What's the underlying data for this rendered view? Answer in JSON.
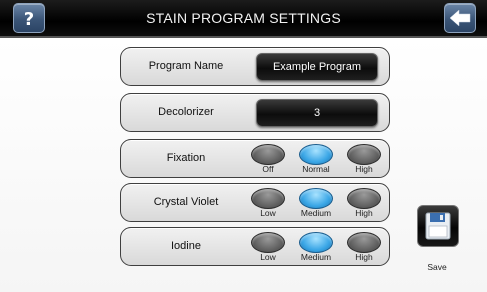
{
  "window": {
    "title": "STAIN PROGRAM SETTINGS"
  },
  "toolbar": {
    "help_icon": "question-mark-icon",
    "back_icon": "back-arrow-icon"
  },
  "settings": {
    "program_name": {
      "label": "Program Name",
      "value": "Example Program"
    },
    "decolorizer": {
      "label": "Decolorizer",
      "value": "3"
    },
    "fixation": {
      "label": "Fixation",
      "options": [
        "Off",
        "Normal",
        "High"
      ],
      "selected": "Normal"
    },
    "crystal_violet": {
      "label": "Crystal Violet",
      "options": [
        "Low",
        "Medium",
        "High"
      ],
      "selected": "Medium"
    },
    "iodine": {
      "label": "Iodine",
      "options": [
        "Low",
        "Medium",
        "High"
      ],
      "selected": "Medium"
    }
  },
  "save": {
    "label": "Save",
    "icon": "floppy-disk-icon"
  },
  "colors": {
    "selected": "#3aa6e6",
    "unselected": "#5e5e5e",
    "header": "#000000"
  }
}
